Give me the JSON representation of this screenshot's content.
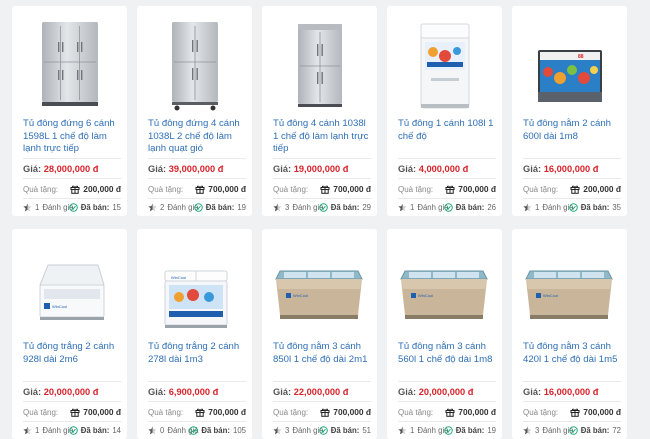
{
  "labels": {
    "price": "Giá:",
    "gift": "Quà tặng:",
    "rating_suffix": "Đánh giá",
    "sold": "Đã bán:"
  },
  "products": [
    {
      "name": "Tủ đông đứng 6 cánh 1598L 1 chế độ làm lạnh trực tiếp",
      "price": "28,000,000 đ",
      "gift": "200,000 đ",
      "ratings": "1",
      "sold": "15",
      "image": "upright-6-door"
    },
    {
      "name": "Tủ đông đứng 4 cánh 1038L 2 chế độ làm lạnh quạt gió",
      "price": "39,000,000 đ",
      "gift": "700,000 đ",
      "ratings": "2",
      "sold": "19",
      "image": "upright-4-door-wheels"
    },
    {
      "name": "Tủ đông 4 cánh 1038l 1 chế độ làm lạnh trực tiếp",
      "price": "19,000,000 đ",
      "gift": "700,000 đ",
      "ratings": "3",
      "sold": "29",
      "image": "upright-4-door"
    },
    {
      "name": "Tủ đông 1 cánh 108l 1 chế độ",
      "price": "4,000,000 đ",
      "gift": "700,000 đ",
      "ratings": "1",
      "sold": "26",
      "image": "chest-1-door-white"
    },
    {
      "name": "Tủ đông nằm 2 cánh 600l dài 1m8",
      "price": "16,000,000 đ",
      "gift": "200,000 đ",
      "ratings": "1",
      "sold": "35",
      "image": "display-freezer-seafood"
    },
    {
      "name": "Tủ đông trắng 2 cánh 928l dài 2m6",
      "price": "20,000,000 đ",
      "gift": "700,000 đ",
      "ratings": "1",
      "sold": "14",
      "image": "chest-2-door-open"
    },
    {
      "name": "Tủ đông trắng 2 cánh 278l dài 1m3",
      "price": "6,900,000 đ",
      "gift": "700,000 đ",
      "ratings": "0",
      "sold": "105",
      "image": "chest-2-door-blue"
    },
    {
      "name": "Tủ đông nằm 3 cánh 850l 1 chế độ dài 2m1",
      "price": "22,000,000 đ",
      "gift": "700,000 đ",
      "ratings": "3",
      "sold": "51",
      "image": "island-freezer"
    },
    {
      "name": "Tủ đông nằm 3 cánh 560l 1 chế độ dài 1m8",
      "price": "20,000,000 đ",
      "gift": "700,000 đ",
      "ratings": "1",
      "sold": "19",
      "image": "island-freezer"
    },
    {
      "name": "Tủ đông nằm 3 cánh 420l 1 chế độ dài 1m5",
      "price": "16,000,000 đ",
      "gift": "700,000 đ",
      "ratings": "3",
      "sold": "72",
      "image": "island-freezer"
    }
  ],
  "colors": {
    "link": "#2f6fb5",
    "price": "#d8232a",
    "sold_icon": "#1aa87a"
  }
}
